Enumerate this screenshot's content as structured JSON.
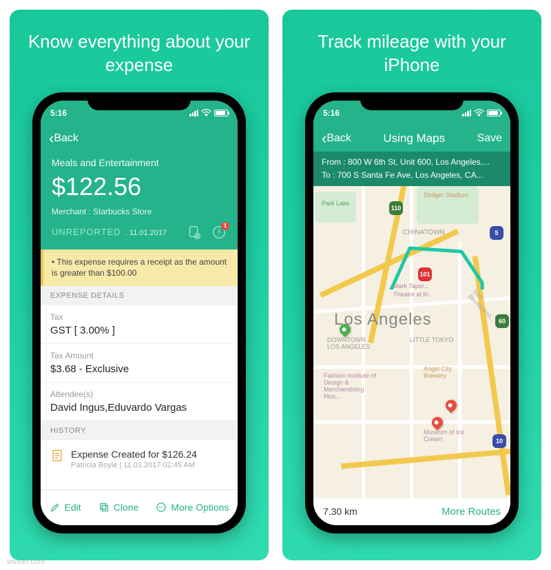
{
  "promo1": {
    "title": "Know everything about your expense"
  },
  "promo2": {
    "title": "Track mileage with your iPhone"
  },
  "status": {
    "time": "5:16"
  },
  "expense": {
    "back": "Back",
    "category": "Meals and Entertainment",
    "amount": "$122.56",
    "merchant": "Merchant : Starbucks Store",
    "status": "UNREPORTED",
    "status_date": ". 11.01.2017",
    "warning": "• This expense requires a receipt as the amount is greater than $100.00",
    "section_details": "EXPENSE DETAILS",
    "section_history": "HISTORY",
    "fields": {
      "tax_label": "Tax",
      "tax_value": "GST [ 3.00% ]",
      "taxamt_label": "Tax Amount",
      "taxamt_value": "$3.68 - Exclusive",
      "att_label": "Attendee(s)",
      "att_value": "David Ingus,Eduvardo Vargas"
    },
    "history": {
      "title": "Expense Created for $126.24",
      "sub": "Patricia Boyle | 11.01.2017 02:45 AM"
    },
    "bottom": {
      "edit": "Edit",
      "clone": "Clone",
      "more": "More Options"
    },
    "notification_badge": "1"
  },
  "maps": {
    "back": "Back",
    "title": "Using Maps",
    "save": "Save",
    "from": "From : 800 W 6th St, Unit 600, Los Angeles,...",
    "to": "To     : 700 S Santa Fe Ave, Los Angeles, CA...",
    "distance": "7.30 km",
    "more_routes": "More Routes",
    "labels": {
      "park_lake": "Park Lake",
      "dodger": "Dodger Stadium",
      "chinatown": "CHINATOWN",
      "downtown": "DOWNTOWN LOS ANGELES",
      "little_tokyo": "LITTLE TOKYO",
      "city": "Los Angeles",
      "fashion": "Fashion Institute of Design & Merchandising Mus...",
      "angel": "Angel City Brewery",
      "museum": "Museum of Ice Cream",
      "mark_taper": "Mark Taper...",
      "theatre": "Theatre at th...",
      "san_bern": "San Bernardino..."
    },
    "hwy": {
      "h101": "101",
      "h110": "110",
      "h10": "10",
      "h60": "60",
      "h5": "5"
    }
  },
  "watermark": "wsxdn.com"
}
